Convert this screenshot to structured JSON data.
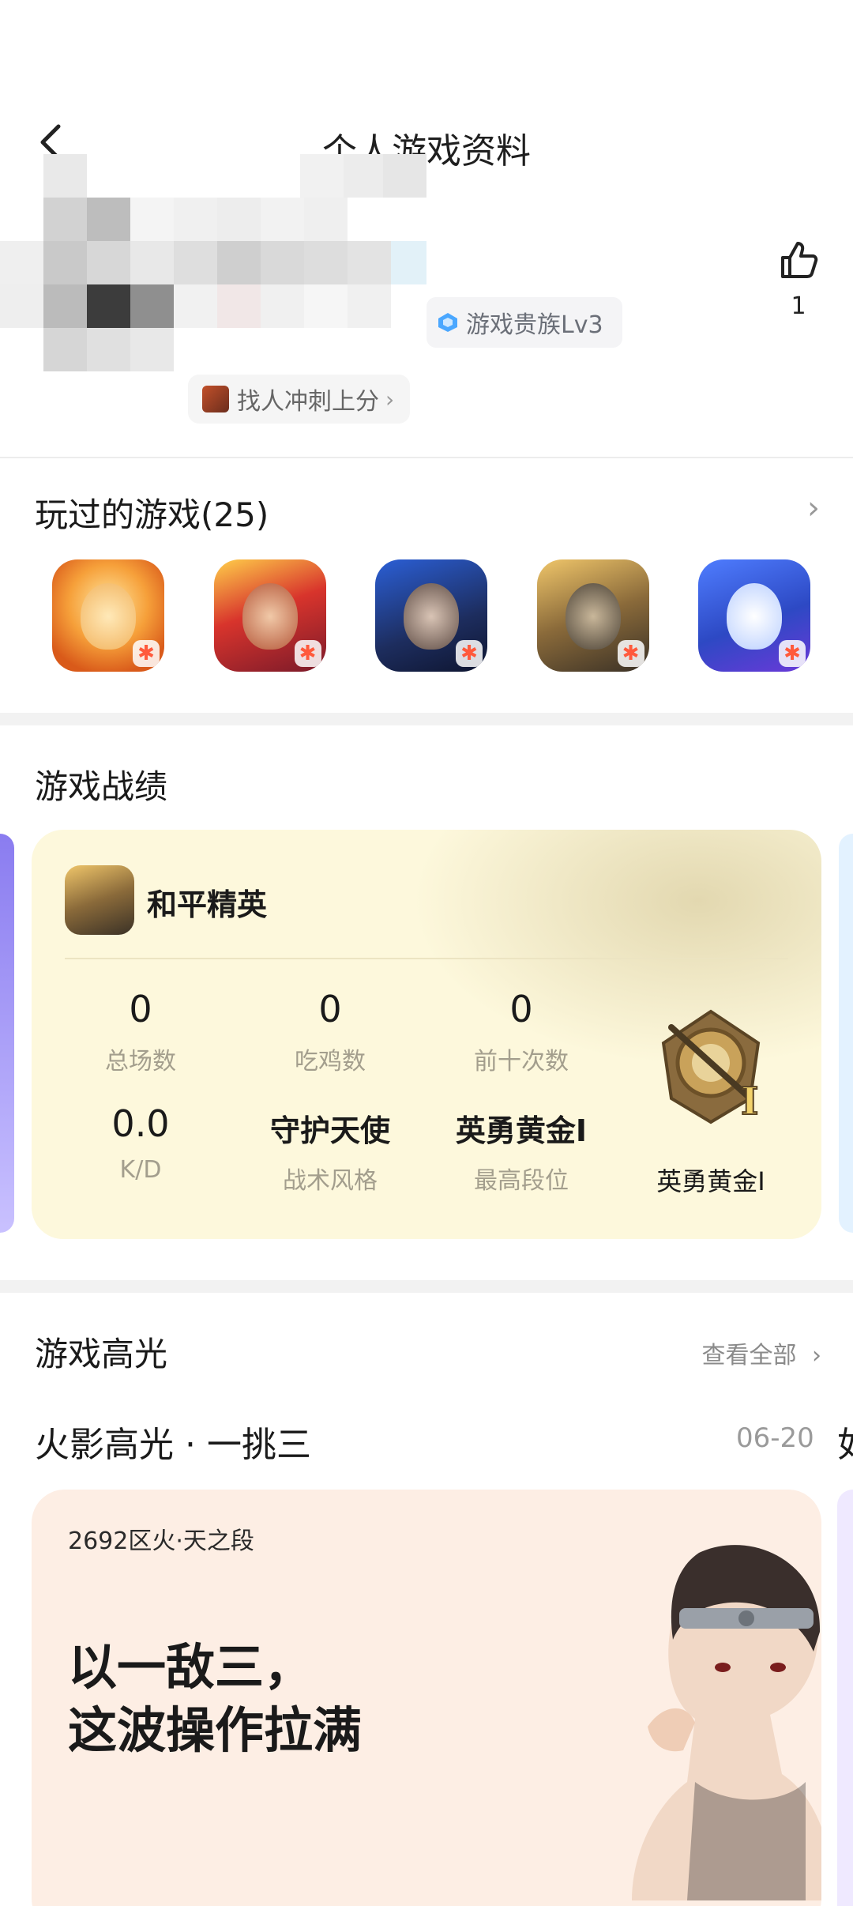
{
  "header": {
    "title": "个人游戏资料"
  },
  "profile": {
    "noble_badge": "游戏贵族Lv3",
    "find_chip": "找人冲刺上分",
    "likes": "1"
  },
  "played_games": {
    "title": "玩过的游戏(25)",
    "icons": [
      "naruto-game-icon",
      "honor-of-kings-icon",
      "crossfire-icon",
      "peace-elite-icon",
      "teamfight-icon"
    ]
  },
  "records": {
    "title": "游戏战绩",
    "game_name": "和平精英",
    "stats": [
      {
        "value": "0",
        "label": "总场数"
      },
      {
        "value": "0",
        "label": "吃鸡数"
      },
      {
        "value": "0",
        "label": "前十次数"
      },
      {
        "value": "0.0",
        "label": "K/D"
      },
      {
        "value": "守护天使",
        "label": "战术风格"
      },
      {
        "value": "英勇黄金Ⅰ",
        "label": "最高段位"
      }
    ],
    "rank_label": "英勇黄金Ⅰ"
  },
  "highlights": {
    "title": "游戏高光",
    "see_all": "查看全部",
    "item_title": "火影高光 · 一挑三",
    "item_date": "06-20",
    "next_peek": "如",
    "card_sub": "2692区火·天之段",
    "card_text_line1": "以一敌三，",
    "card_text_line2": "这波操作拉满"
  },
  "colors": {
    "record_card_bg": "#fdf8dc",
    "highlight_card_bg": "#fdeee4",
    "muted_label": "#a39e8d"
  }
}
